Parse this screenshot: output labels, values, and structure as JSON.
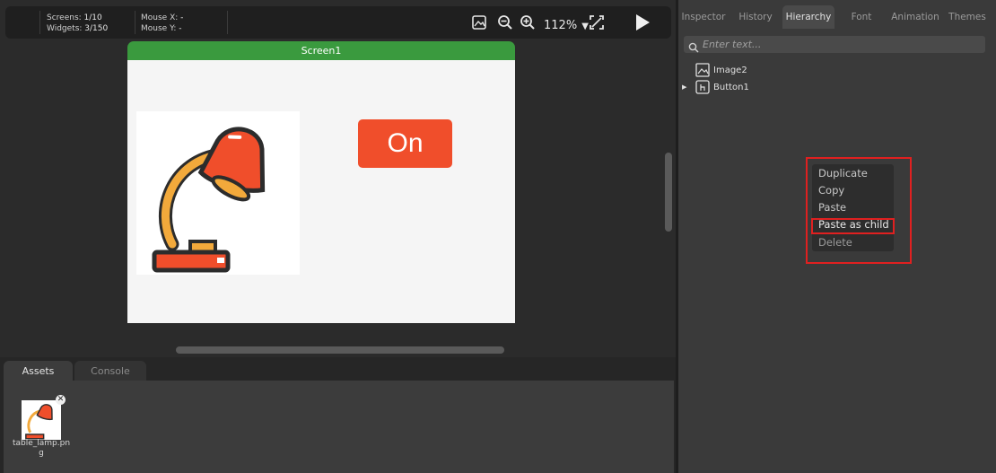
{
  "toolbar": {
    "screens_label": "Screens:",
    "screens_value": "1/10",
    "widgets_label": "Widgets:",
    "widgets_value": "3/150",
    "mouse_x_label": "Mouse X:",
    "mouse_x_value": "-",
    "mouse_y_label": "Mouse Y:",
    "mouse_y_value": "-",
    "zoom": "112%"
  },
  "canvas": {
    "screen_name": "Screen1",
    "button_text": "On"
  },
  "bottom_tabs": [
    "Assets",
    "Console"
  ],
  "assets": [
    {
      "name": "table_lamp.png"
    }
  ],
  "right_tabs": [
    "Inspector",
    "History",
    "Hierarchy",
    "Font",
    "Animation",
    "Themes"
  ],
  "active_right_tab": "Hierarchy",
  "search": {
    "placeholder": "Enter text..."
  },
  "hierarchy": [
    {
      "label": "Image2",
      "icon": "image-icon"
    },
    {
      "label": "Button1",
      "icon": "hand-pointer-icon"
    }
  ],
  "context_menu": {
    "items": [
      "Duplicate",
      "Copy",
      "Paste",
      "Paste as child",
      "Delete"
    ],
    "highlighted": "Paste as child"
  },
  "colors": {
    "screen_tab": "#3a9a3e",
    "button": "#f04e2b",
    "highlight": "#e02020"
  }
}
